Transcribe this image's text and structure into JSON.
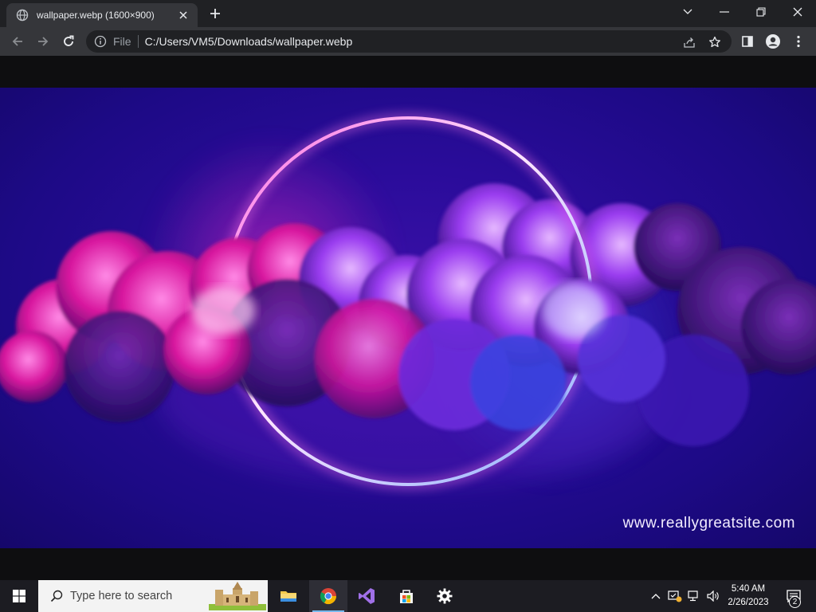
{
  "browser": {
    "tab": {
      "title": "wallpaper.webp (1600×900)",
      "favicon": "globe-icon"
    },
    "window_controls": [
      "chevron-down-icon",
      "minimize-icon",
      "restore-icon",
      "close-icon"
    ],
    "toolbar": {
      "back": "back-arrow-icon",
      "forward": "forward-arrow-icon",
      "reload": "reload-icon",
      "omnibox": {
        "chip": "File",
        "url": "C:/Users/VM5/Downloads/wallpaper.webp"
      },
      "right_icons": [
        "share-icon",
        "bookmark-star-icon",
        "side-panel-icon",
        "profile-icon",
        "more-menu-icon"
      ]
    }
  },
  "image": {
    "watermark": "www.reallygreatsite.com",
    "colors": {
      "ring": "#ffd6ff",
      "cloud_pink": "#e01bb4",
      "cloud_violet": "#8a3cff",
      "background": "#1d0a86"
    }
  },
  "taskbar": {
    "search_placeholder": "Type here to search",
    "apps": [
      "file-explorer-icon",
      "chrome-icon",
      "visual-studio-icon",
      "microsoft-store-icon",
      "settings-icon"
    ],
    "active_app": "chrome-icon",
    "tray": [
      "show-hidden-icons-chevron",
      "security-icon",
      "network-icon",
      "volume-icon"
    ],
    "clock": {
      "time": "5:40 AM",
      "date": "2/26/2023"
    },
    "notifications_count": "2"
  }
}
